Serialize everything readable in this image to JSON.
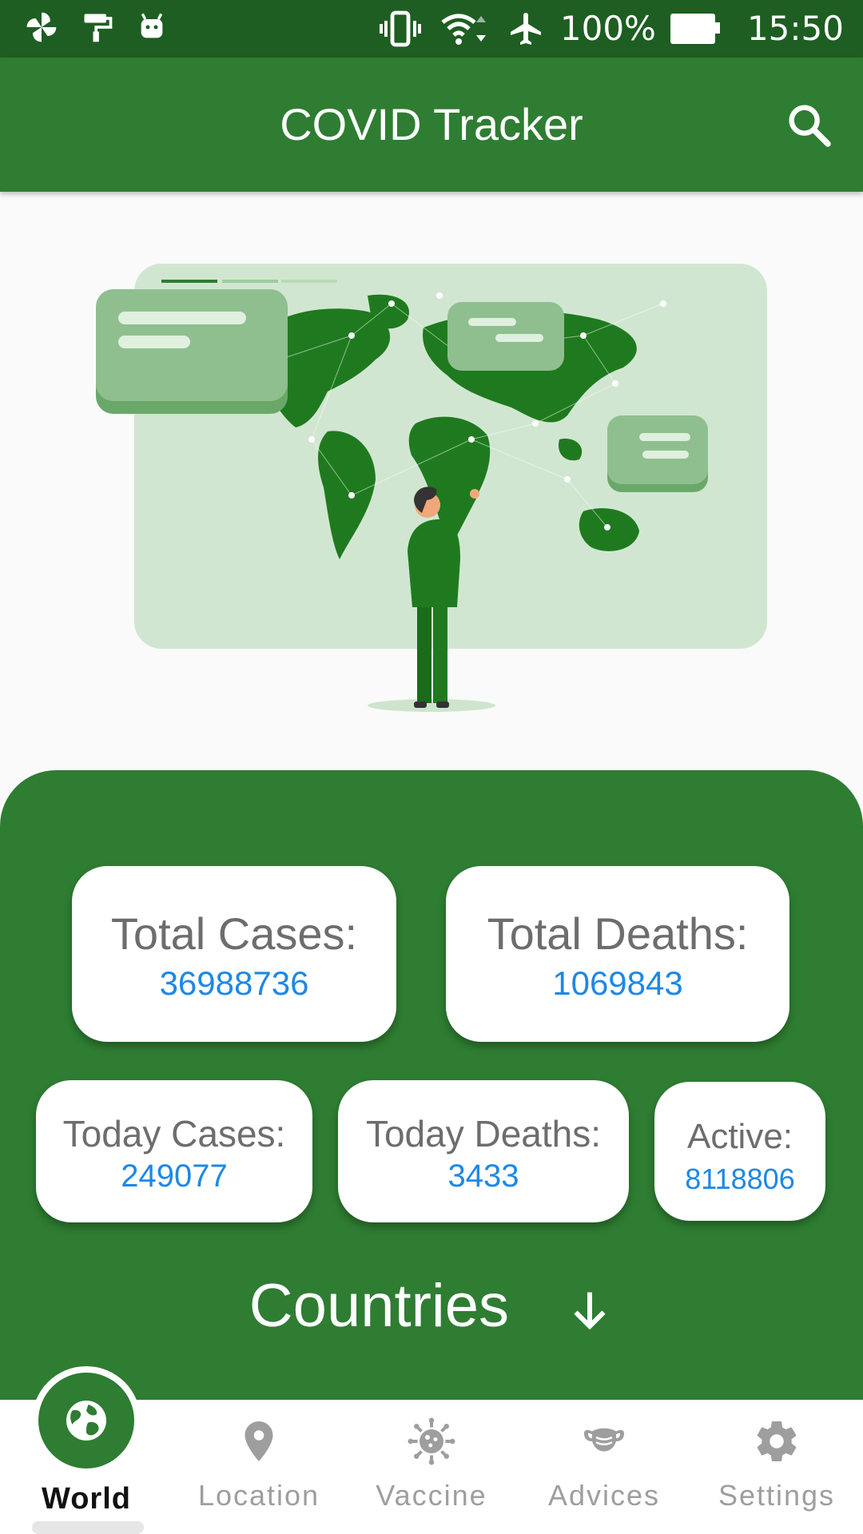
{
  "status_bar": {
    "battery": "100%",
    "time": "15:50"
  },
  "app_bar": {
    "title": "COVID Tracker",
    "search_icon": "search-icon"
  },
  "stats": {
    "total_cases": {
      "label": "Total Cases:",
      "value": "36988736"
    },
    "total_deaths": {
      "label": "Total Deaths:",
      "value": "1069843"
    },
    "today_cases": {
      "label": "Today Cases:",
      "value": "249077"
    },
    "today_deaths": {
      "label": "Today Deaths:",
      "value": "3433"
    },
    "active": {
      "label": "Active:",
      "value": "8118806"
    }
  },
  "countries": {
    "label": "Countries",
    "icon": "arrow-down-icon"
  },
  "bottom_nav": {
    "items": [
      {
        "label": "World",
        "icon": "globe-icon",
        "selected": true
      },
      {
        "label": "Location",
        "icon": "location-pin-icon"
      },
      {
        "label": "Vaccine",
        "icon": "virus-icon"
      },
      {
        "label": "Advices",
        "icon": "mask-icon"
      },
      {
        "label": "Settings",
        "icon": "gear-icon"
      }
    ]
  },
  "colors": {
    "primary": "#2e7d32",
    "status_bar": "#1e5e22",
    "value_blue": "#1e88e5",
    "label_gray": "#6d6d6d"
  }
}
